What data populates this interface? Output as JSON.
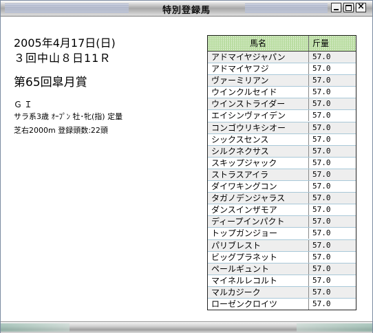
{
  "window": {
    "title": "特別登録馬"
  },
  "race": {
    "date": "2005年4月17日(日)",
    "id": "３回中山８日11Ｒ",
    "name": "第65回皐月賞",
    "grade": "ＧＩ",
    "conditions": "サラ系3歳 ｵｰﾌﾟﾝ 牡･牝(指) 定量",
    "course": "芝右2000m  登録頭数:22頭"
  },
  "table": {
    "headers": {
      "name": "馬名",
      "weight": "斤量"
    },
    "rows": [
      {
        "name": "アドマイヤジャパン",
        "weight": "57.0"
      },
      {
        "name": "アドマイヤフジ",
        "weight": "57.0"
      },
      {
        "name": "ヴァーミリアン",
        "weight": "57.0"
      },
      {
        "name": "ウインクルセイド",
        "weight": "57.0"
      },
      {
        "name": "ウインストライダー",
        "weight": "57.0"
      },
      {
        "name": "エイシンヴァイデン",
        "weight": "57.0"
      },
      {
        "name": "コンゴウリキシオー",
        "weight": "57.0"
      },
      {
        "name": "シックスセンス",
        "weight": "57.0"
      },
      {
        "name": "シルクネクサス",
        "weight": "57.0"
      },
      {
        "name": "スキップジャック",
        "weight": "57.0"
      },
      {
        "name": "ストラスアイラ",
        "weight": "57.0"
      },
      {
        "name": "ダイワキングコン",
        "weight": "57.0"
      },
      {
        "name": "タガノデンジャラス",
        "weight": "57.0"
      },
      {
        "name": "ダンスインザモア",
        "weight": "57.0"
      },
      {
        "name": "ディープインパクト",
        "weight": "57.0"
      },
      {
        "name": "トップガンジョー",
        "weight": "57.0"
      },
      {
        "name": "パリブレスト",
        "weight": "57.0"
      },
      {
        "name": "ビッグプラネット",
        "weight": "57.0"
      },
      {
        "name": "ペールギュント",
        "weight": "57.0"
      },
      {
        "name": "マイネルレコルト",
        "weight": "57.0"
      },
      {
        "name": "マルカジーク",
        "weight": "57.0"
      },
      {
        "name": "ローゼンクロイツ",
        "weight": "57.0"
      }
    ]
  },
  "colors": {
    "header_bg": "#b8dca0",
    "row_border": "#a8c8d8"
  }
}
